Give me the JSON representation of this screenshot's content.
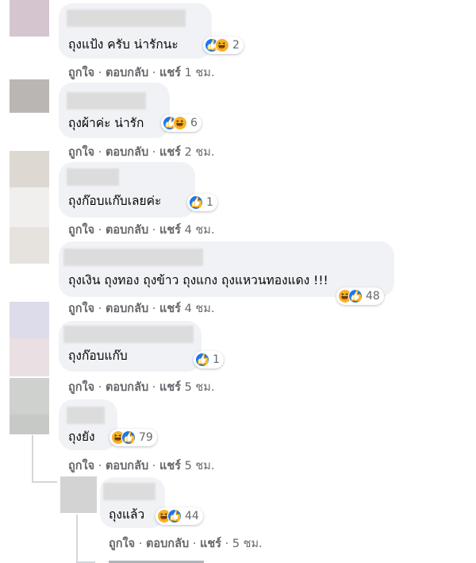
{
  "comments": [
    {
      "text": "ถุงแป้ง ครับ น่ารักนะ",
      "reactions": "2",
      "like_label": "ถูกใจ",
      "reply_label": "ตอบกลับ",
      "share_label": "แชร์",
      "time": "1 ชม."
    },
    {
      "text": "ถุงผ้าค่ะ น่ารัก",
      "reactions": "6",
      "like_label": "ถูกใจ",
      "reply_label": "ตอบกลับ",
      "share_label": "แชร์",
      "time": "2 ชม."
    },
    {
      "text": "ถุงก๊อบแก๊บเลยค่ะ",
      "reactions": "1",
      "like_label": "ถูกใจ",
      "reply_label": "ตอบกลับ",
      "share_label": "แชร์",
      "time": "4 ชม."
    },
    {
      "text": "ถุงเงิน ถุงทอง ถุงข้าว ถุงแกง ถุงแหวนทองแดง !!!",
      "reactions": "48",
      "like_label": "ถูกใจ",
      "reply_label": "ตอบกลับ",
      "share_label": "แชร์",
      "time": "4 ชม."
    },
    {
      "text": "ถุงก๊อบแก๊บ",
      "reactions": "1",
      "like_label": "ถูกใจ",
      "reply_label": "ตอบกลับ",
      "share_label": "แชร์",
      "time": "5 ชม."
    },
    {
      "text": "ถุงยัง",
      "reactions": "79",
      "like_label": "ถูกใจ",
      "reply_label": "ตอบกลับ",
      "share_label": "แชร์",
      "time": "5 ชม."
    },
    {
      "text": "ถุงแล้ว",
      "reactions": "44",
      "like_label": "ถูกใจ",
      "reply_label": "ตอบกลับ",
      "share_label": "แชร์",
      "time": "5 ชม."
    }
  ],
  "colors": {
    "bubble": "#f0f2f5",
    "meta": "#65676b",
    "like": "#1877f2",
    "haha": "#f7b125"
  }
}
